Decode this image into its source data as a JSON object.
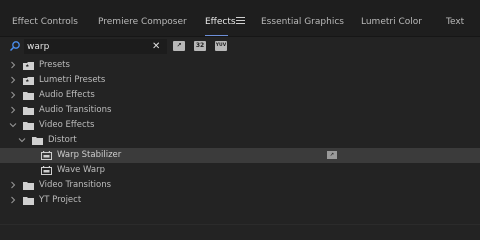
{
  "tabs": [
    {
      "label": "Effect Controls"
    },
    {
      "label": "Premiere Composer"
    },
    {
      "label": "Effects"
    },
    {
      "label": "Essential Graphics"
    },
    {
      "label": "Lumetri Color"
    },
    {
      "label": "Text"
    }
  ],
  "active_tab": "Effects",
  "search": {
    "value": "warp"
  },
  "filter_buttons": [
    {
      "icon": "accelerated-effects-icon",
      "text": "↗"
    },
    {
      "icon": "32-bit-color-icon",
      "text": "32"
    },
    {
      "icon": "yuv-effects-icon",
      "text": "YUV"
    }
  ],
  "tree": [
    {
      "label": "Presets",
      "icon": "preset-bin-icon",
      "expanded": false
    },
    {
      "label": "Lumetri Presets",
      "icon": "preset-bin-icon",
      "expanded": false
    },
    {
      "label": "Audio Effects",
      "icon": "folder-icon",
      "expanded": false
    },
    {
      "label": "Audio Transitions",
      "icon": "folder-icon",
      "expanded": false
    },
    {
      "label": "Video Effects",
      "icon": "folder-icon",
      "expanded": true
    },
    {
      "label": "Distort",
      "icon": "folder-icon",
      "expanded": true
    },
    {
      "label": "Warp Stabilizer",
      "icon": "effect-icon",
      "selected": true,
      "accelerated": true
    },
    {
      "label": "Wave Warp",
      "icon": "effect-icon"
    },
    {
      "label": "Video Transitions",
      "icon": "folder-icon",
      "expanded": false
    },
    {
      "label": "YT Project",
      "icon": "folder-icon",
      "expanded": false
    }
  ],
  "colors": {
    "background": "#232323",
    "selection": "#3b3b3b",
    "accent": "#6d8fd8"
  }
}
